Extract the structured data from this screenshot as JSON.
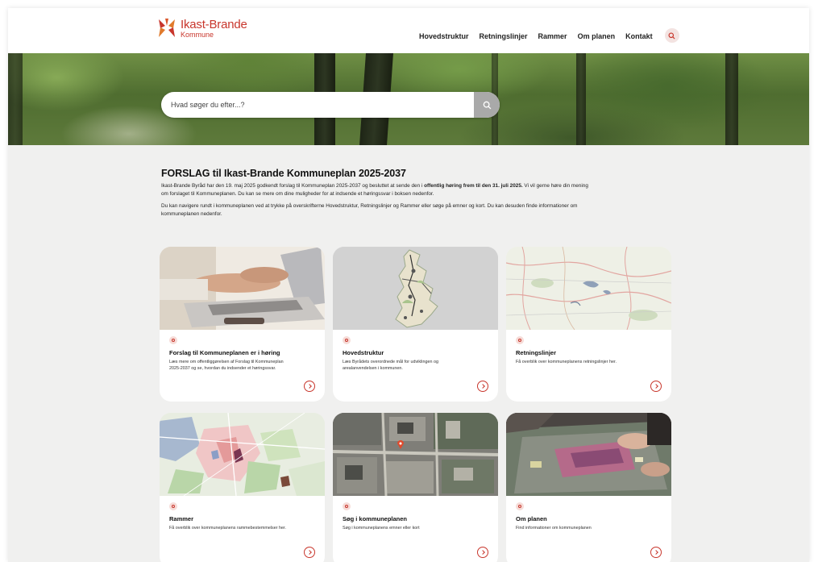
{
  "header": {
    "logo_name": "Ikast-Brande",
    "logo_sub": "Kommune",
    "nav": [
      "Hovedstruktur",
      "Retningslinjer",
      "Rammer",
      "Om planen",
      "Kontakt"
    ],
    "accent": "#c8362c"
  },
  "hero": {
    "search_placeholder": "Hvad søger du efter...?",
    "search_icon": "search-icon"
  },
  "intro": {
    "title": "FORSLAG til Ikast-Brande Kommuneplan 2025-2037",
    "p1_a": "Ikast-Brande Byråd har den 19. maj 2025 godkendt forslag til Kommuneplan 2025-2037 og besluttet at sende den i ",
    "p1_bold": "offentlig høring frem til den 31. juli 2025.",
    "p1_b": " Vi vil gerne høre din mening om forslaget til Kommuneplanen. Du kan se mere om dine muligheder for at indsende et høringssvar i boksen nedenfor.",
    "p2": "Du kan navigere rundt i kommuneplanen ved at trykke på overskrifterne Hovedstruktur, Retningslinjer og Rammer eller søge på emner og kort. Du kan desuden finde informationer om kommuneplanen nedenfor."
  },
  "cards": [
    {
      "title": "Forslag til Kommuneplanen er i høring",
      "desc": "Læs mere om offentliggørelsen af Forslag til Kommuneplan 2025-2037 og se, hvordan du indsender et høringssvar."
    },
    {
      "title": "Hovedstruktur",
      "desc": "Læs Byrådets overordnede mål for udviklingen og arealanvendelsen i kommunen."
    },
    {
      "title": "Retningslinjer",
      "desc": "Få overblik over kommuneplanens retningslinjer her."
    },
    {
      "title": "Rammer",
      "desc": "Få overblik over kommuneplanens rammebestemmelser her."
    },
    {
      "title": "Søg i kommuneplanen",
      "desc": "Søg i kommuneplanens emner eller kort"
    },
    {
      "title": "Om planen",
      "desc": "Find informationer om kommuneplanen"
    }
  ]
}
